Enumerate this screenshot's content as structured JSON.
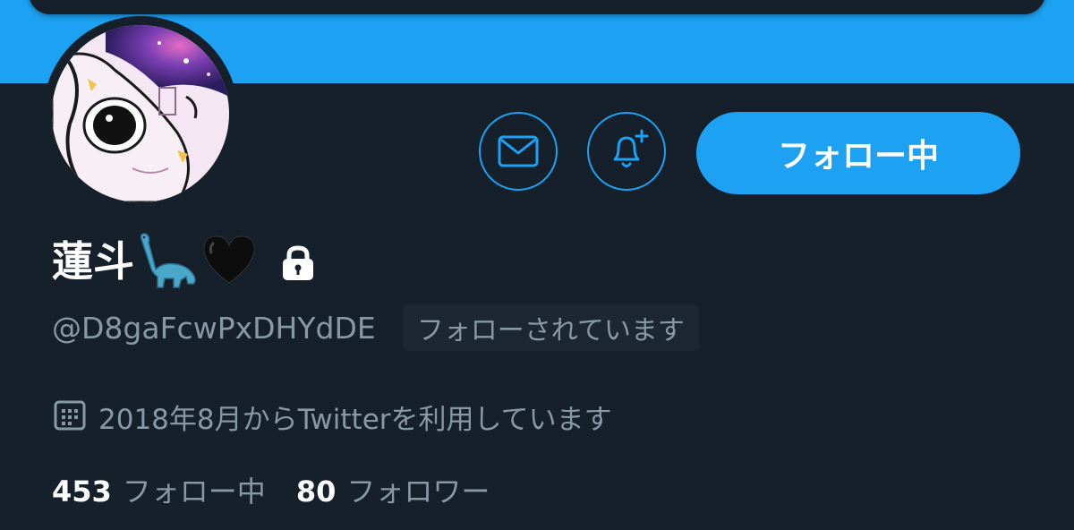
{
  "profile": {
    "display_name": "蓮斗",
    "name_emojis": [
      "sauropod-emoji",
      "black-heart-emoji"
    ],
    "protected": true,
    "handle": "@D8gaFcwPxDHYdDE",
    "follows_you_label": "フォローされています",
    "joined_text": "2018年8月からTwitterを利用しています"
  },
  "actions": {
    "message_icon": "envelope-icon",
    "notify_icon": "bell-plus-icon",
    "follow_label": "フォロー中"
  },
  "stats": {
    "following_count": "453",
    "following_label": "フォロー中",
    "followers_count": "80",
    "followers_label": "フォロワー"
  },
  "colors": {
    "background": "#15202b",
    "banner": "#1da1f2",
    "accent": "#1da1f2",
    "secondary_text": "#8899a6"
  }
}
